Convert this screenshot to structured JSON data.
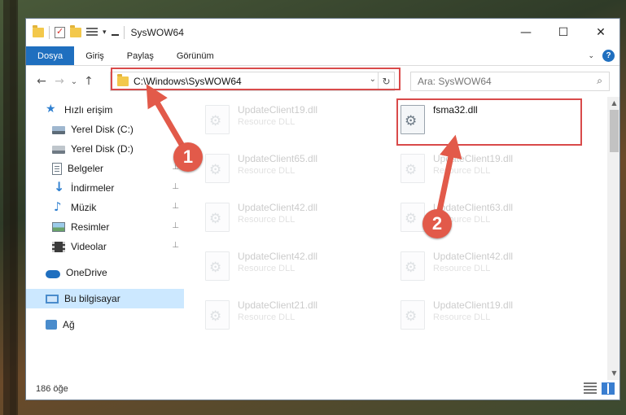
{
  "titlebar": {
    "title": "SysWOW64",
    "minimize_glyph": "—",
    "maximize_glyph": "☐",
    "close_glyph": "✕"
  },
  "ribbon": {
    "tabs": [
      {
        "label": "Dosya"
      },
      {
        "label": "Giriş"
      },
      {
        "label": "Paylaş"
      },
      {
        "label": "Görünüm"
      }
    ],
    "help_label": "?"
  },
  "navigation": {
    "back_glyph": "←",
    "forward_glyph": "→",
    "recent_glyph": "⌄",
    "up_glyph": "↑"
  },
  "address": {
    "path": "C:\\Windows\\SysWOW64",
    "refresh_glyph": "↻",
    "dropdown_glyph": "⌄"
  },
  "search": {
    "placeholder": "Ara: SysWOW64",
    "icon": "search-icon"
  },
  "sidebar": {
    "items": [
      {
        "label": "Hızlı erişim",
        "icon": "star-icon"
      },
      {
        "label": "Yerel Disk (C:)",
        "icon": "drive-c-icon"
      },
      {
        "label": "Yerel Disk (D:)",
        "icon": "drive-d-icon"
      },
      {
        "label": "Belgeler",
        "icon": "documents-icon",
        "pinned": true
      },
      {
        "label": "İndirmeler",
        "icon": "downloads-icon",
        "pinned": true
      },
      {
        "label": "Müzik",
        "icon": "music-icon",
        "pinned": true
      },
      {
        "label": "Resimler",
        "icon": "pictures-icon",
        "pinned": true
      },
      {
        "label": "Videolar",
        "icon": "videos-icon",
        "pinned": true
      },
      {
        "label": "OneDrive",
        "icon": "cloud-icon"
      },
      {
        "label": "Bu bilgisayar",
        "icon": "pc-icon",
        "selected": true
      },
      {
        "label": "Ağ",
        "icon": "network-icon"
      }
    ],
    "pin_glyph": "📌"
  },
  "files": [
    {
      "name": "UpdateClient19.dll",
      "type": "Resource DLL",
      "faded": true
    },
    {
      "name": "fsma32.dll",
      "type": "",
      "faded": false,
      "highlighted": true
    },
    {
      "name": "UpdateClient65.dll",
      "type": "Resource DLL",
      "faded": true
    },
    {
      "name": "UpdateClient19.dll",
      "type": "Resource DLL",
      "faded": true
    },
    {
      "name": "UpdateClient42.dll",
      "type": "Resource DLL",
      "faded": true
    },
    {
      "name": "UpdateClient63.dll",
      "type": "Resource DLL",
      "faded": true
    },
    {
      "name": "UpdateClient42.dll",
      "type": "Resource DLL",
      "faded": true
    },
    {
      "name": "UpdateClient42.dll",
      "type": "Resource DLL",
      "faded": true
    },
    {
      "name": "UpdateClient21.dll",
      "type": "Resource DLL",
      "faded": true
    },
    {
      "name": "UpdateClient19.dll",
      "type": "Resource DLL",
      "faded": true
    }
  ],
  "statusbar": {
    "item_count": "186 öğe"
  },
  "annotations": {
    "step1": "1",
    "step2": "2",
    "color": "#e25a4a"
  }
}
